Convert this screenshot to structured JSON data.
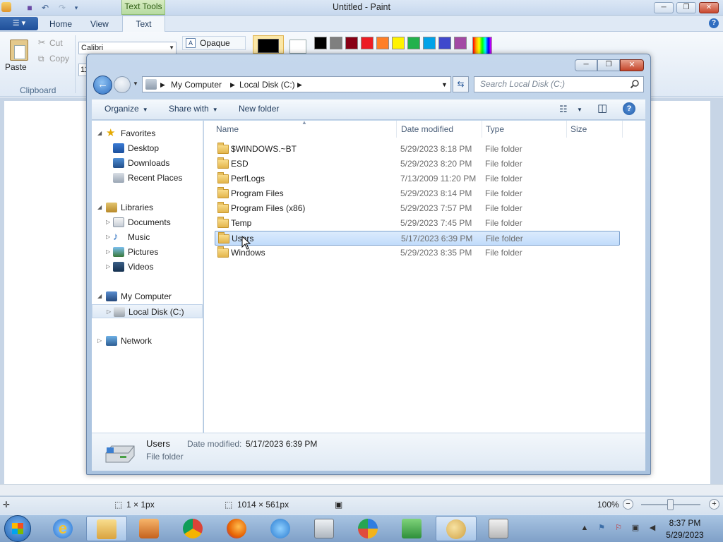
{
  "paint": {
    "title": "Untitled - Paint",
    "text_tools_tab": "Text Tools",
    "tabs": [
      "Home",
      "View",
      "Text"
    ],
    "clipboard": {
      "paste": "Paste",
      "cut": "Cut",
      "copy": "Copy",
      "group": "Clipboard"
    },
    "font_name": "Calibri",
    "font_size": "11",
    "opaque": "Opaque",
    "palette": [
      "#000000",
      "#7f7f7f",
      "#880015",
      "#ed1c24",
      "#ff7f27",
      "#fff200",
      "#22b14c",
      "#00a2e8",
      "#3f48cc",
      "#a349a4"
    ],
    "status": {
      "selection": "1 × 1px",
      "canvas_size": "1014 × 561px",
      "zoom": "100%"
    }
  },
  "explorer": {
    "breadcrumb": [
      "My Computer",
      "Local Disk (C:)"
    ],
    "search_placeholder": "Search Local Disk (C:)",
    "commands": {
      "organize": "Organize",
      "share": "Share with",
      "new_folder": "New folder"
    },
    "nav": {
      "favorites": "Favorites",
      "favorites_items": [
        "Desktop",
        "Downloads",
        "Recent Places"
      ],
      "libraries": "Libraries",
      "library_items": [
        "Documents",
        "Music",
        "Pictures",
        "Videos"
      ],
      "computer": "My Computer",
      "computer_items": [
        "Local Disk (C:)"
      ],
      "network": "Network"
    },
    "columns": {
      "name": "Name",
      "date": "Date modified",
      "type": "Type",
      "size": "Size"
    },
    "files": [
      {
        "name": "$WINDOWS.~BT",
        "date": "5/29/2023 8:18 PM",
        "type": "File folder"
      },
      {
        "name": "ESD",
        "date": "5/29/2023 8:20 PM",
        "type": "File folder"
      },
      {
        "name": "PerfLogs",
        "date": "7/13/2009 11:20 PM",
        "type": "File folder"
      },
      {
        "name": "Program Files",
        "date": "5/29/2023 8:14 PM",
        "type": "File folder"
      },
      {
        "name": "Program Files (x86)",
        "date": "5/29/2023 7:57 PM",
        "type": "File folder"
      },
      {
        "name": "Temp",
        "date": "5/29/2023 7:45 PM",
        "type": "File folder"
      },
      {
        "name": "Users",
        "date": "5/17/2023 6:39 PM",
        "type": "File folder"
      },
      {
        "name": "Windows",
        "date": "5/29/2023 8:35 PM",
        "type": "File folder"
      }
    ],
    "selected_index": 6,
    "details": {
      "name": "Users",
      "date_label": "Date modified:",
      "date_value": "5/17/2023 6:39 PM",
      "type": "File folder"
    }
  },
  "taskbar": {
    "time": "8:37 PM",
    "date": "5/29/2023"
  }
}
